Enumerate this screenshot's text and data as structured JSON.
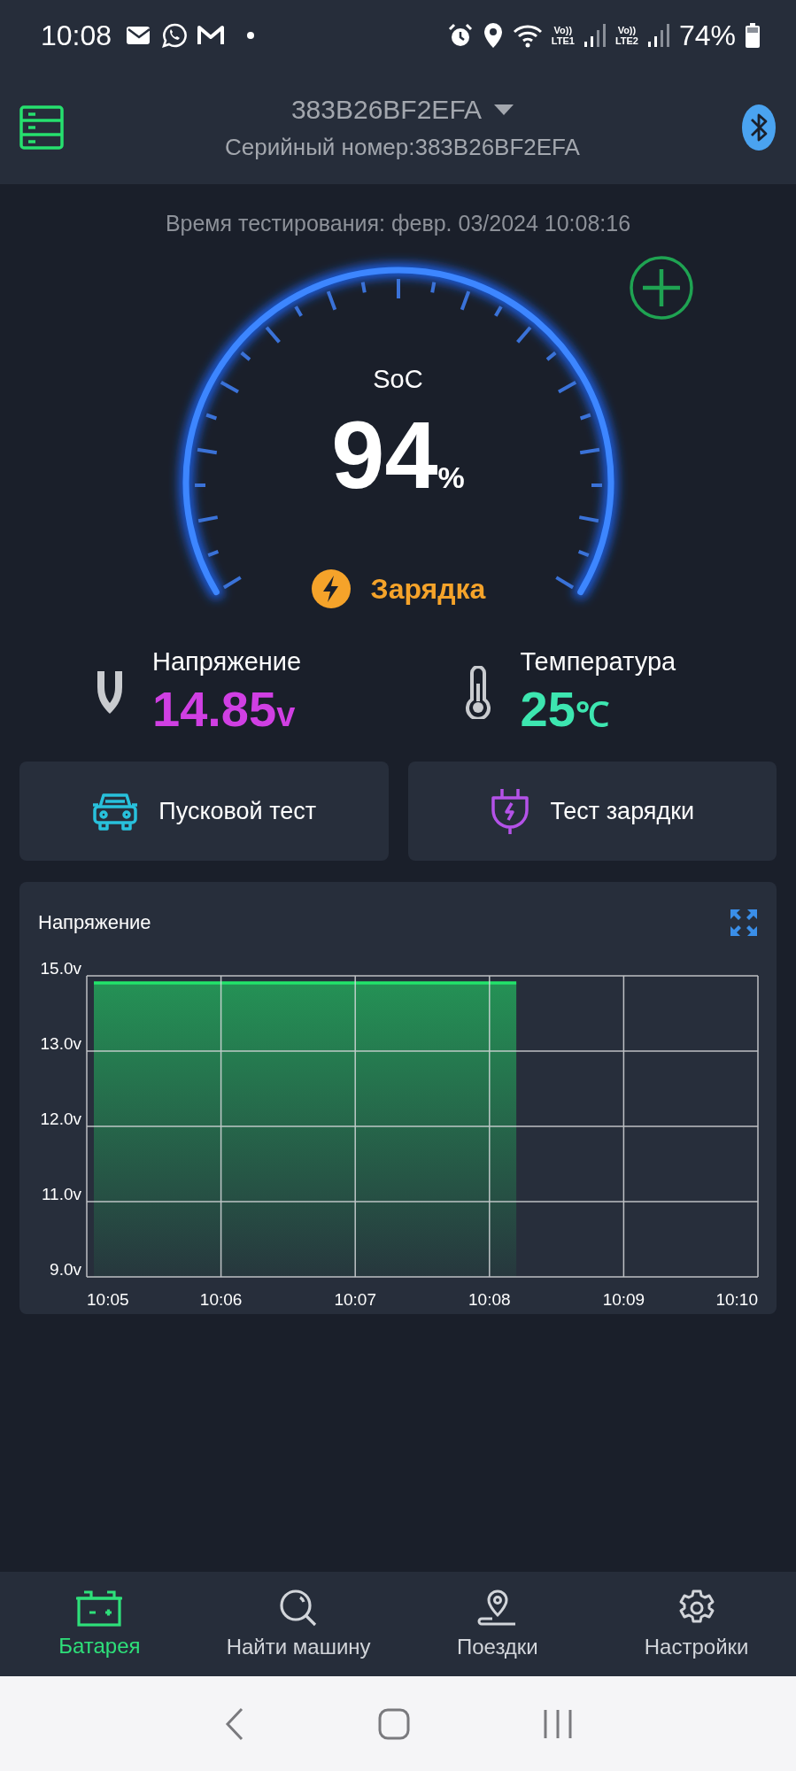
{
  "status_bar": {
    "time": "10:08",
    "network_labels": [
      {
        "top": "Vo))",
        "bottom": "LTE1"
      },
      {
        "top": "Vo))",
        "bottom": "LTE2"
      }
    ],
    "battery": "74%"
  },
  "header": {
    "device": "383B26BF2EFA",
    "serial": "Серийный номер:383B26BF2EFA"
  },
  "test_time": "Время тестирования: февр. 03/2024 10:08:16",
  "gauge": {
    "label": "SoC",
    "value": "94",
    "unit": "%",
    "status": "Зарядка"
  },
  "metrics": [
    {
      "kind": "voltage",
      "label": "Напряжение",
      "value": "14.85",
      "unit": "v",
      "color": "#d03fe3"
    },
    {
      "kind": "temperature",
      "label": "Температура",
      "value": "25",
      "unit": "℃",
      "color": "#3de6b0"
    }
  ],
  "actions": [
    {
      "kind": "car",
      "label": "Пусковой тест"
    },
    {
      "kind": "plug",
      "label": "Тест зарядки"
    }
  ],
  "chart_card": {
    "title": "Напряжение",
    "y_axis_labels": [
      "15.0v",
      "13.0v",
      "12.0v",
      "11.0v",
      "9.0v"
    ],
    "x_axis_labels": [
      "10:05",
      "10:06",
      "10:07",
      "10:08",
      "10:09",
      "10:10"
    ]
  },
  "tabs": [
    {
      "kind": "battery",
      "label": "Батарея",
      "selected": true
    },
    {
      "kind": "search",
      "label": "Найти машину",
      "selected": false
    },
    {
      "kind": "trips",
      "label": "Поездки",
      "selected": false
    },
    {
      "kind": "settings",
      "label": "Настройки",
      "selected": false
    }
  ]
}
